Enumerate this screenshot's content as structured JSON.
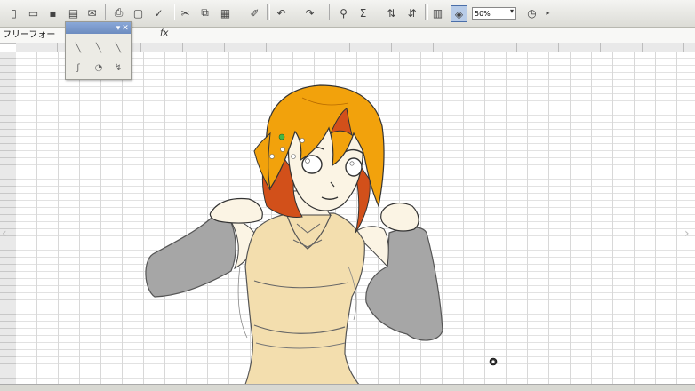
{
  "app": {
    "zoom_value": "50%",
    "name_box": "フリーフォー",
    "fx_label": "fx"
  },
  "toolbar": {
    "icons": [
      "new-icon",
      "open-icon",
      "save-icon",
      "permission-icon",
      "email-icon",
      "print-icon",
      "print-preview-icon",
      "spelling-icon",
      "cut-icon",
      "copy-icon",
      "paste-icon",
      "format-painter-icon",
      "undo-icon",
      "redo-icon",
      "hyperlink-icon",
      "autosum-icon",
      "sort-ascending-icon",
      "sort-descending-icon",
      "chart-wizard-icon",
      "drawing-icon",
      "zoom-dropdown",
      "help-icon"
    ]
  },
  "palette": {
    "tools": [
      "line-tool-icon",
      "freeform-tool-icon",
      "scribble-tool-icon",
      "curve-tool-icon",
      "edit-points-icon",
      "close-curve-icon"
    ]
  },
  "colors": {
    "hair": "#f2a20c",
    "hair_dark": "#d2501a",
    "skin": "#fbf4e4",
    "dress": "#f3deae",
    "sleeve": "#a6a6a6",
    "line": "#3a3a3a",
    "grid": "#d8d8d8",
    "toolbar": "#e8e8e4"
  }
}
